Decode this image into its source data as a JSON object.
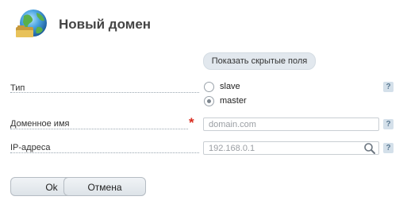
{
  "header": {
    "title": "Новый домен",
    "icon": "globe-folder-icon"
  },
  "toggle_hidden_fields": "Показать скрытые поля",
  "form": {
    "type": {
      "label": "Тип",
      "options": [
        {
          "label": "slave",
          "selected": false
        },
        {
          "label": "master",
          "selected": true
        }
      ]
    },
    "domain_name": {
      "label": "Доменное имя",
      "placeholder": "domain.com",
      "value": "",
      "required": true,
      "required_mark": "*"
    },
    "ip_address": {
      "label": "IP-адреса",
      "placeholder": "192.168.0.1",
      "value": ""
    }
  },
  "help_label": "?",
  "buttons": {
    "ok": "Ok",
    "cancel": "Отмена"
  },
  "colors": {
    "required": "#d92c1f",
    "help_bg": "#d4e0ea",
    "toggle_bg": "#e2e8ee"
  }
}
